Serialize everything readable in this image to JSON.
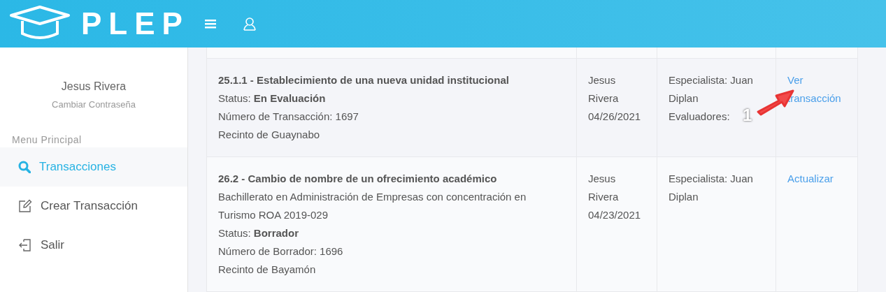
{
  "header": {
    "brand": "PLEP"
  },
  "sidebar": {
    "user_name": "Jesus Rivera",
    "change_password": "Cambiar Contraseña",
    "section_title": "Menu Principal",
    "items": [
      {
        "label": "Transacciones",
        "selected": true
      },
      {
        "label": "Crear Transacción",
        "selected": false
      },
      {
        "label": "Salir",
        "selected": false
      }
    ]
  },
  "table": {
    "rows": [
      {
        "title": "25.1.1 - Establecimiento de una nueva unidad institucional",
        "details": [
          "Status: **En Evaluación**",
          "Número de Transacción: 1697",
          "Recinto de Guaynabo"
        ],
        "author": "Jesus Rivera",
        "date": "04/26/2021",
        "reviewers": [
          "Especialista: Juan Diplan",
          "Evaluadores:"
        ],
        "action": "Ver transacción",
        "annotation": "1"
      },
      {
        "title": "26.2 - Cambio de nombre de un ofrecimiento académico",
        "details": [
          "Bachillerato en Administración de Empresas con concentración en Turismo ROA 2019-029",
          "Status: **Borrador**",
          "Número de Borrador: 1696",
          "Recinto de Bayamón"
        ],
        "author": "Jesus Rivera",
        "date": "04/23/2021",
        "reviewers": [
          "Especialista: Juan Diplan"
        ],
        "action": "Actualizar"
      }
    ]
  }
}
